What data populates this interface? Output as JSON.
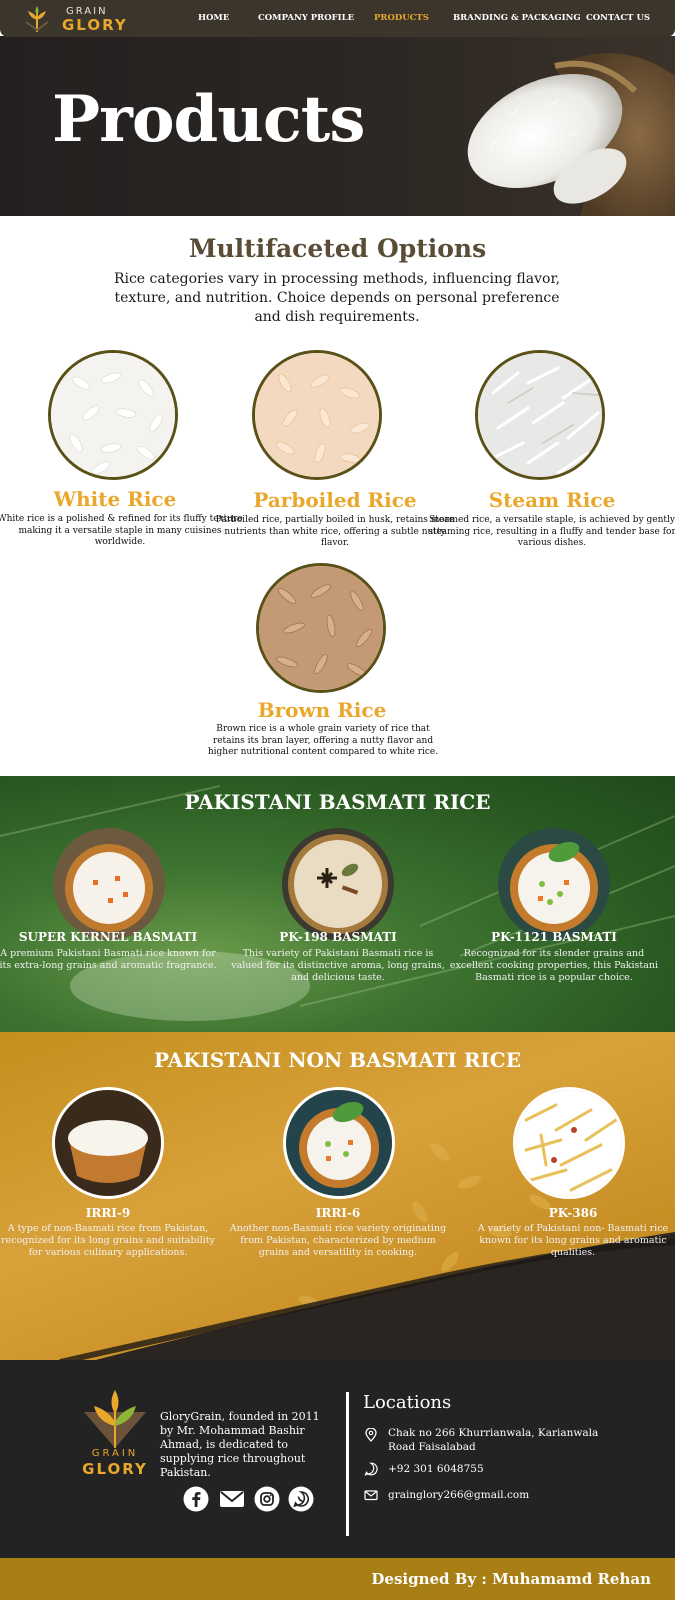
{
  "brand": {
    "grain": "GRAIN",
    "glory": "GLORY"
  },
  "nav": [
    {
      "label": "HOME",
      "active": false
    },
    {
      "label": "COMPANY PROFILE",
      "active": false
    },
    {
      "label": "PRODUCTS",
      "active": true
    },
    {
      "label": "BRANDING & PACKAGING",
      "active": false
    },
    {
      "label": "CONTACT US",
      "active": false
    }
  ],
  "hero": {
    "title": "Products"
  },
  "options": {
    "title": "Multifaceted Options",
    "description": "Rice categories vary in processing methods, influencing flavor, texture, and nutrition. Choice depends on personal preference and dish requirements.",
    "items": [
      {
        "name": "White Rice",
        "description": "White rice is a polished & refined for its fluffy texture making it a versatile staple in many cuisines worldwide."
      },
      {
        "name": "Parboiled Rice",
        "description": "Parboiled rice, partially boiled in husk, retains more nutrients than white rice, offering a subtle nutty flavor."
      },
      {
        "name": "Steam Rice",
        "description": "Steamed rice, a versatile staple, is achieved by gently steaming rice, resulting in a fluffy and tender base for various dishes."
      },
      {
        "name": "Brown Rice",
        "description": "Brown rice is a whole grain variety of rice that retains its bran layer, offering a nutty flavor and higher nutritional content compared to white rice."
      }
    ]
  },
  "basmati": {
    "title": "PAKISTANI BASMATI RICE",
    "items": [
      {
        "name": "SUPER KERNEL BASMATI",
        "description": "A premium Pakistani Basmati rice known for its extra-long grains and aromatic fragrance."
      },
      {
        "name": "PK-198 BASMATI",
        "description": "This variety of Pakistani Basmati rice is valued for its distinctive aroma, long grains, and delicious taste."
      },
      {
        "name": "PK-1121 BASMATI",
        "description": "Recognized for its slender grains and excellent cooking properties, this Pakistani Basmati rice is a popular choice."
      }
    ]
  },
  "non_basmati": {
    "title": "PAKISTANI NON BASMATI RICE",
    "items": [
      {
        "name": "IRRI-9",
        "description": "A type of non-Basmati rice from Pakistan, recognized for its long grains and suitability for various culinary applications."
      },
      {
        "name": "IRRI-6",
        "description": "Another non-Basmati rice variety originating from Pakistan, characterized by medium grains and versatility in cooking."
      },
      {
        "name": "PK-386",
        "description": "A variety of Pakistani non- Basmati rice known for its long grains and aromatic qualities."
      }
    ]
  },
  "footer": {
    "logo_grain": "GRAIN",
    "logo_glory": "GLORY",
    "about": "GloryGrain, founded in 2011 by Mr. Mohammad Bashir Ahmad, is dedicated to supplying rice throughout Pakistan.",
    "locations_title": "Locations",
    "address": "Chak no 266 Khurrianwala, Karianwala Road Faisalabad",
    "phone": "+92 301 6048755",
    "email": "grainglory266@gmail.com",
    "social": [
      "facebook-icon",
      "mail-icon",
      "instagram-icon",
      "whatsapp-icon"
    ]
  },
  "credit": "Designed By : Muhamamd Rehan",
  "colors": {
    "accent": "#e9a72b",
    "nav_bg": "#3b352c",
    "footer_bg": "#232323",
    "credit_bg": "#a77f15",
    "heading_brown": "#5a4c36"
  }
}
